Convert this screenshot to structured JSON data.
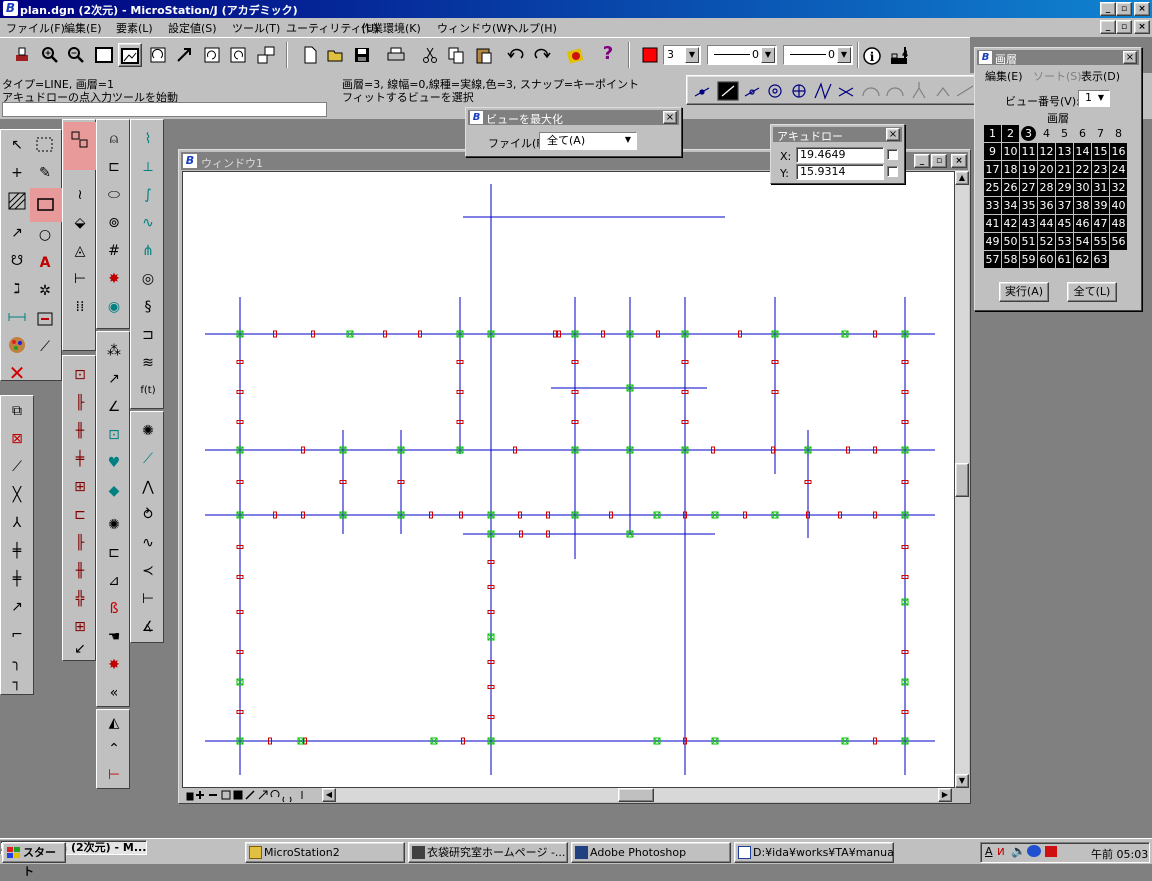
{
  "app": {
    "title": "plan.dgn (2次元) - MicroStation/J (アカデミック)",
    "icon": "microstation-icon",
    "window_controls": [
      "_",
      "▫",
      "×"
    ]
  },
  "menu": [
    "ファイル(F)",
    "編集(E)",
    "要素(L)",
    "設定値(S)",
    "ツール(T)",
    "ユーティリティ(U)",
    "作業環境(K)",
    "ウィンドウ(W)",
    "ヘルプ(H)"
  ],
  "toolbar": {
    "color_value": "3",
    "weight_value": "0",
    "style_value": "0"
  },
  "status": {
    "line1_left": "タイプ=LINE, 画層=1",
    "line2_left": "アキュドローの点入力ツールを始動",
    "line1_right": "画層=3, 線幅=0,線種=実線,色=3, スナップ=キーポイント",
    "line2_right": "フィットするビューを選択"
  },
  "maximize_dialog": {
    "title": "ビューを最大化",
    "file_label": "ファイル(F):",
    "file_value": "全て(A)"
  },
  "accudraw": {
    "title": "アキュドロー",
    "x_label": "X:",
    "x_value": "19.4649",
    "y_label": "Y:",
    "y_value": "15.9314"
  },
  "view": {
    "title": "ウィンドウ1"
  },
  "levels": {
    "title": "画層",
    "menu": [
      "編集(E)",
      "ソート(S)",
      "表示(D)"
    ],
    "view_label": "ビュー番号(V):",
    "view_value": "1",
    "grid_title": "画層",
    "active_level": 3,
    "levels": [
      1,
      2,
      3,
      4,
      5,
      6,
      7,
      8,
      9,
      10,
      11,
      12,
      13,
      14,
      15,
      16,
      17,
      18,
      19,
      20,
      21,
      22,
      23,
      24,
      25,
      26,
      27,
      28,
      29,
      30,
      31,
      32,
      33,
      34,
      35,
      36,
      37,
      38,
      39,
      40,
      41,
      42,
      43,
      44,
      45,
      46,
      47,
      48,
      49,
      50,
      51,
      52,
      53,
      54,
      55,
      56,
      57,
      58,
      59,
      60,
      61,
      62,
      63
    ],
    "off_levels": [
      4,
      5,
      6,
      7,
      8
    ],
    "apply_button": "実行(A)",
    "all_button": "全て(L)"
  },
  "taskbar": {
    "start": "スタート",
    "tasks": [
      "plan.dgn (2次元) - M...",
      "MicroStation2",
      "衣袋研究室ホームページ -...",
      "Adobe Photoshop",
      "D:¥ida¥works¥TA¥manual..."
    ],
    "clock": "午前 05:03"
  },
  "colors": {
    "title_active": "#000080",
    "title_inactive": "#808080",
    "plan_line": "#0000c8",
    "keypoint_green": "#00c000",
    "keypoint_red": "#d00000",
    "palette_highlight": "#e89a9a"
  }
}
